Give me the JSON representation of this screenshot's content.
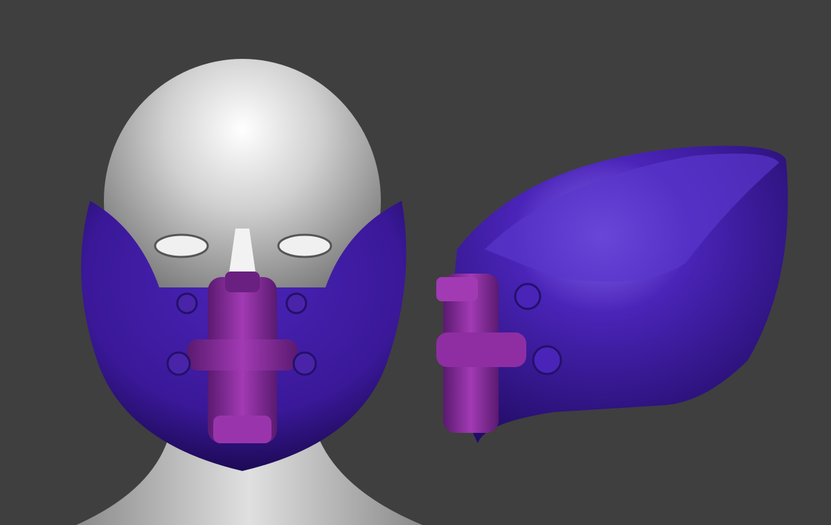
{
  "scene": {
    "subject_left": "head-with-mask-front",
    "subject_right": "mask-side-view",
    "colors": {
      "background": "#3f3f3f",
      "skin": "#d9d9d9",
      "mask": "#3d1a9e",
      "mask_highlight": "#7a55e0",
      "filter": "#8a2d9e",
      "filter_shadow": "#4e1560"
    }
  }
}
